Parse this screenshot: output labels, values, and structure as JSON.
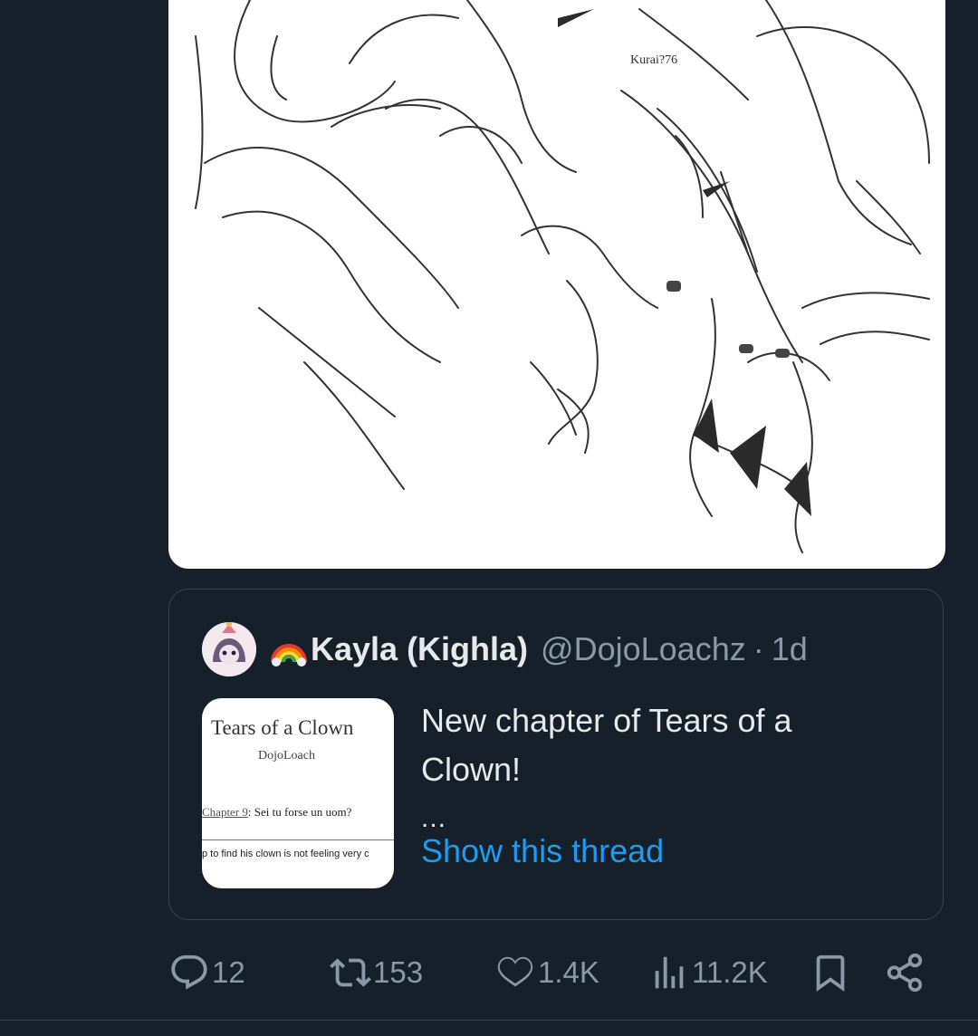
{
  "quote_tweet": {
    "emoji": "🌈",
    "display_name": "Kayla (Kighla)",
    "handle": "@DojoLoachz",
    "separator": "·",
    "time": "1d",
    "text": "New chapter of Tears of a Clown!",
    "ellipsis": "...",
    "show_thread": "Show this thread",
    "thumbnail": {
      "title": "Tears of a Clown",
      "author": "DojoLoach",
      "chapter_prefix": "Chapter 9",
      "chapter_rest": ": Sei tu forse un uom?",
      "snippet": "p to find his clown is not feeling very c"
    },
    "media_signature": "Kurai?76"
  },
  "actions": {
    "replies": "12",
    "retweets": "153",
    "likes": "1.4K",
    "views": "11.2K"
  },
  "colors": {
    "background": "#15202b",
    "border": "#38444d",
    "muted": "#8b98a5",
    "link": "#1d9bf0",
    "text": "#e7e9ea"
  }
}
